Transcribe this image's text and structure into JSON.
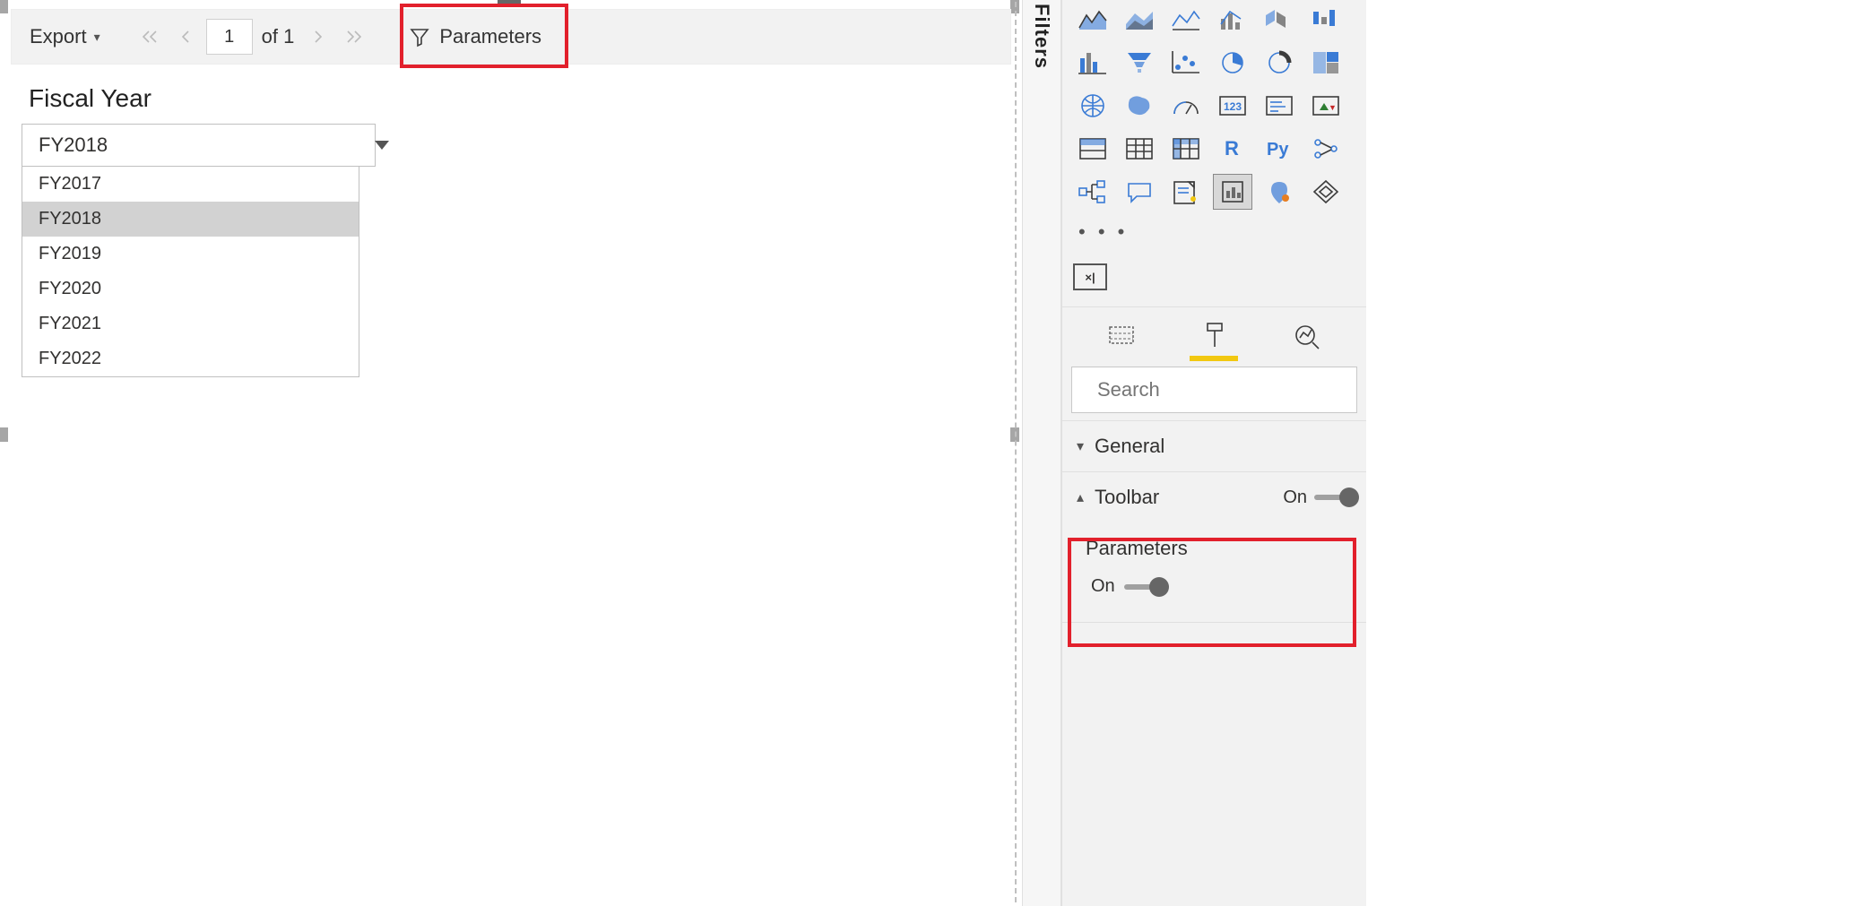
{
  "toolbar": {
    "export_label": "Export",
    "page_current": "1",
    "page_of": "of 1",
    "parameters_label": "Parameters"
  },
  "report": {
    "param_label": "Fiscal Year",
    "dropdown_selected": "FY2018",
    "dropdown_items": [
      "FY2017",
      "FY2018",
      "FY2019",
      "FY2020",
      "FY2021",
      "FY2022"
    ]
  },
  "filters_pane_label": "Filters",
  "viz": {
    "value_icon_text": "×|",
    "search_placeholder": "Search",
    "general_label": "General",
    "toolbar_section_label": "Toolbar",
    "toolbar_toggle_label": "On",
    "parameters_section_label": "Parameters",
    "parameters_toggle_label": "On"
  }
}
